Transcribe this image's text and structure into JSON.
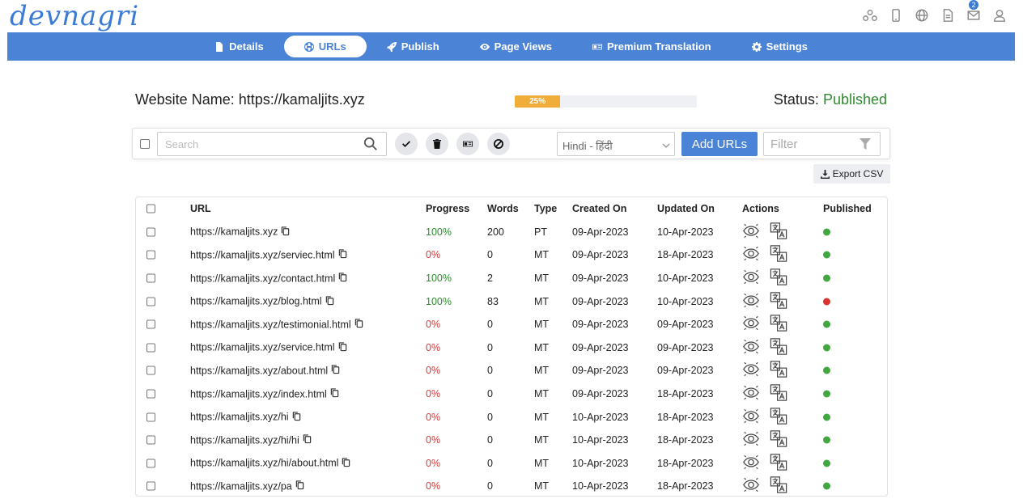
{
  "brand": {
    "logo_text": "devnagri"
  },
  "header_icons": [
    {
      "name": "network-icon"
    },
    {
      "name": "mobile-icon"
    },
    {
      "name": "globe-icon"
    },
    {
      "name": "document-icon"
    },
    {
      "name": "mail-icon",
      "badge": "2"
    },
    {
      "name": "user-icon"
    }
  ],
  "nav": {
    "tabs": [
      {
        "label": "Details",
        "icon": "file-icon",
        "active": false
      },
      {
        "label": "URLs",
        "icon": "globe-icon",
        "active": true
      },
      {
        "label": "Publish",
        "icon": "rocket-icon",
        "active": false
      },
      {
        "label": "Page Views",
        "icon": "eye-icon",
        "active": false
      },
      {
        "label": "Premium Translation",
        "icon": "id-card-icon",
        "active": false
      },
      {
        "label": "Settings",
        "icon": "gear-icon",
        "active": false
      }
    ]
  },
  "website": {
    "name_text": "Website Name: https://kamaljits.xyz",
    "progress": 25,
    "progress_label": "25%",
    "status_label": "Status:",
    "status_value": "Published"
  },
  "toolbar": {
    "search_placeholder": "Search",
    "language": "Hindi - हिंदी",
    "add_label": "Add URLs",
    "filter_placeholder": "Filter",
    "export_label": "Export CSV"
  },
  "table": {
    "columns": [
      "URL",
      "Progress",
      "Words",
      "Type",
      "Created On",
      "Updated On",
      "Actions",
      "Published"
    ],
    "rows": [
      {
        "url": "https://kamaljits.xyz",
        "progress": "100%",
        "words": "200",
        "type": "PT",
        "created": "09-Apr-2023",
        "updated": "10-Apr-2023",
        "published": "green"
      },
      {
        "url": "https://kamaljits.xyz/serviec.html",
        "progress": "0%",
        "words": "0",
        "type": "MT",
        "created": "09-Apr-2023",
        "updated": "18-Apr-2023",
        "published": "green"
      },
      {
        "url": "https://kamaljits.xyz/contact.html",
        "progress": "100%",
        "words": "2",
        "type": "MT",
        "created": "09-Apr-2023",
        "updated": "10-Apr-2023",
        "published": "green"
      },
      {
        "url": "https://kamaljits.xyz/blog.html",
        "progress": "100%",
        "words": "83",
        "type": "MT",
        "created": "09-Apr-2023",
        "updated": "10-Apr-2023",
        "published": "red"
      },
      {
        "url": "https://kamaljits.xyz/testimonial.html",
        "progress": "0%",
        "words": "0",
        "type": "MT",
        "created": "09-Apr-2023",
        "updated": "09-Apr-2023",
        "published": "green"
      },
      {
        "url": "https://kamaljits.xyz/service.html",
        "progress": "0%",
        "words": "0",
        "type": "MT",
        "created": "09-Apr-2023",
        "updated": "09-Apr-2023",
        "published": "green"
      },
      {
        "url": "https://kamaljits.xyz/about.html",
        "progress": "0%",
        "words": "0",
        "type": "MT",
        "created": "09-Apr-2023",
        "updated": "09-Apr-2023",
        "published": "green"
      },
      {
        "url": "https://kamaljits.xyz/index.html",
        "progress": "0%",
        "words": "0",
        "type": "MT",
        "created": "09-Apr-2023",
        "updated": "18-Apr-2023",
        "published": "green"
      },
      {
        "url": "https://kamaljits.xyz/hi",
        "progress": "0%",
        "words": "0",
        "type": "MT",
        "created": "10-Apr-2023",
        "updated": "18-Apr-2023",
        "published": "green"
      },
      {
        "url": "https://kamaljits.xyz/hi/hi",
        "progress": "0%",
        "words": "0",
        "type": "MT",
        "created": "10-Apr-2023",
        "updated": "18-Apr-2023",
        "published": "green"
      },
      {
        "url": "https://kamaljits.xyz/hi/about.html",
        "progress": "0%",
        "words": "0",
        "type": "MT",
        "created": "10-Apr-2023",
        "updated": "18-Apr-2023",
        "published": "green"
      },
      {
        "url": "https://kamaljits.xyz/pa",
        "progress": "0%",
        "words": "0",
        "type": "MT",
        "created": "10-Apr-2023",
        "updated": "18-Apr-2023",
        "published": "green"
      }
    ]
  },
  "colors": {
    "accent": "#4b83d6",
    "progress": "#f0ad3a",
    "success": "#2e8b2e",
    "danger": "#d23c3c",
    "published_green": "#3fa83f",
    "published_red": "#e03131"
  }
}
